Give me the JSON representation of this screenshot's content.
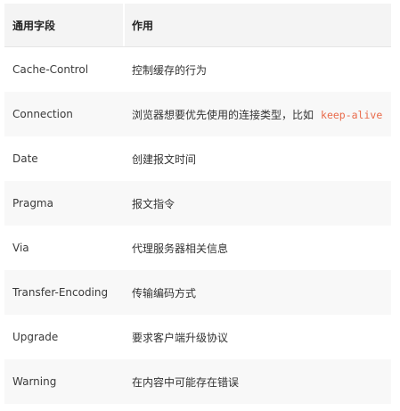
{
  "header": {
    "col1": "通用字段",
    "col2": "作用"
  },
  "rows": [
    {
      "field": "Cache-Control",
      "desc": "控制缓存的行为",
      "code": ""
    },
    {
      "field": "Connection",
      "desc": "浏览器想要优先使用的连接类型，比如",
      "code": "keep-alive"
    },
    {
      "field": "Date",
      "desc": "创建报文时间",
      "code": ""
    },
    {
      "field": "Pragma",
      "desc": "报文指令",
      "code": ""
    },
    {
      "field": "Via",
      "desc": "代理服务器相关信息",
      "code": ""
    },
    {
      "field": "Transfer-Encoding",
      "desc": "传输编码方式",
      "code": ""
    },
    {
      "field": "Upgrade",
      "desc": "要求客户端升级协议",
      "code": ""
    },
    {
      "field": "Warning",
      "desc": "在内容中可能存在错误",
      "code": ""
    }
  ]
}
